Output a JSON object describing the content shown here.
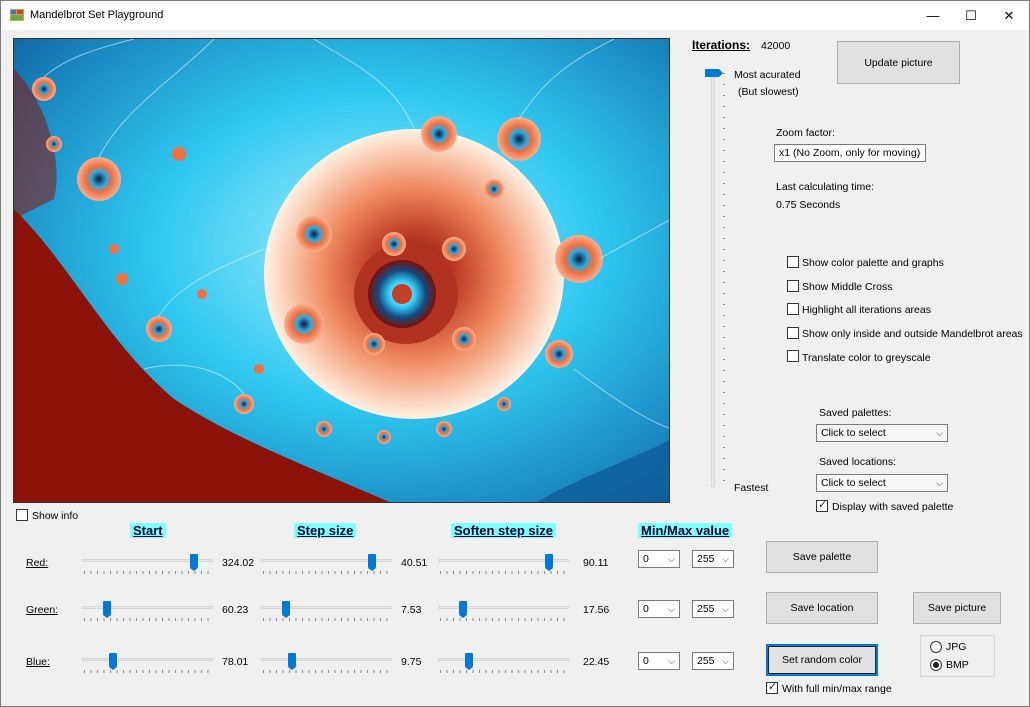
{
  "window": {
    "title": "Mandelbrot Set Playground",
    "controls": {
      "minimize": "—",
      "maximize": "☐",
      "close": "✕"
    }
  },
  "iterations": {
    "label": "Iterations:",
    "value": "42000",
    "slider_top_label": "Most acurated",
    "slider_top_sublabel": "(But slowest)",
    "slider_bottom_label": "Fastest"
  },
  "update_button": "Update picture",
  "zoom": {
    "label": "Zoom factor:",
    "selected": "x1 (No Zoom, only for moving)"
  },
  "calc_time": {
    "label": "Last calculating time:",
    "value": "0.75 Seconds"
  },
  "options": [
    {
      "label": "Show color palette and graphs",
      "checked": false
    },
    {
      "label": "Show Middle Cross",
      "checked": false
    },
    {
      "label": "Highlight all iterations areas",
      "checked": false
    },
    {
      "label": "Show only inside and outside Mandelbrot areas",
      "checked": false
    },
    {
      "label": "Translate color to greyscale",
      "checked": false
    }
  ],
  "saved_palettes": {
    "label": "Saved palettes:",
    "selected": "Click to select"
  },
  "saved_locations": {
    "label": "Saved locations:",
    "selected": "Click to select"
  },
  "display_saved_palette": {
    "label": "Display with saved palette",
    "checked": true
  },
  "show_info": {
    "label": "Show info",
    "checked": false
  },
  "headers": {
    "start": "Start",
    "step": "Step size",
    "soften": "Soften step size",
    "minmax": "Min/Max value"
  },
  "rows": [
    {
      "label": "Red:",
      "start": "324.02",
      "step": "40.51",
      "soften": "90.11",
      "min": "0",
      "max": "255",
      "start_pos": 0.88,
      "step_pos": 0.87,
      "soften_pos": 0.87
    },
    {
      "label": "Green:",
      "start": "60.23",
      "step": "7.53",
      "soften": "17.56",
      "min": "0",
      "max": "255",
      "start_pos": 0.17,
      "step_pos": 0.17,
      "soften_pos": 0.17
    },
    {
      "label": "Blue:",
      "start": "78.01",
      "step": "9.75",
      "soften": "22.45",
      "min": "0",
      "max": "255",
      "start_pos": 0.22,
      "step_pos": 0.22,
      "soften_pos": 0.22
    }
  ],
  "buttons": {
    "save_palette": "Save  palette",
    "save_location": "Save location",
    "save_picture": "Save picture",
    "set_random_color": "Set random color"
  },
  "full_range": {
    "label": "With full min/max range",
    "checked": true
  },
  "format": [
    {
      "label": "JPG",
      "checked": false
    },
    {
      "label": "BMP",
      "checked": true
    }
  ],
  "colors": {
    "accent": "#0078d7",
    "heading_bg": "#7fffff",
    "fractal_cyan": "#2fc8f0",
    "fractal_red": "#8a1208",
    "fractal_orange": "#f07040",
    "fractal_cream": "#fff0e0"
  }
}
